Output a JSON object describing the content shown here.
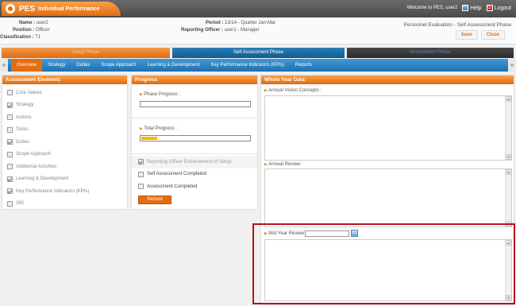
{
  "app": {
    "logo": "PES",
    "title": "Individual Performance",
    "welcome": "Welcome to PES, user2",
    "help": "Help",
    "logout": "Logout"
  },
  "info": {
    "name_label": "Name :",
    "name_value": "user2",
    "position_label": "Position :",
    "position_value": "Officer",
    "classification_label": "Classification :",
    "classification_value": "T1",
    "period_label": "Period :",
    "period_value": "13/14 - Quarter Jan-Mar",
    "officer_label": "Reporting Officer :",
    "officer_value": "user1 - Manager",
    "evaluation_title": "Personnel Evaluation - Self Assessment Phase",
    "save": "Save",
    "close": "Close"
  },
  "phases": [
    "Setup Phase",
    "Self Assessment Phase",
    "Assessment Phase"
  ],
  "tabs": [
    "Overview",
    "Strategy",
    "Duties",
    "Scope Approach",
    "Learning & Development",
    "Key Performance Indicators (KPIs)",
    "Reports"
  ],
  "assessment": {
    "title": "Assessment Elements",
    "items": [
      {
        "label": "Core Values",
        "checked": false
      },
      {
        "label": "Strategy",
        "checked": true
      },
      {
        "label": "Actions",
        "checked": false
      },
      {
        "label": "Tasks",
        "checked": false
      },
      {
        "label": "Duties",
        "checked": true
      },
      {
        "label": "Scope Approach",
        "checked": false
      },
      {
        "label": "Additional Activities",
        "checked": false
      },
      {
        "label": "Learning & Development",
        "checked": true
      },
      {
        "label": "Key Performance Indicators (KPIs)",
        "checked": true
      },
      {
        "label": "360",
        "checked": false
      }
    ]
  },
  "progress": {
    "title": "Progress",
    "phase_label": "Phase Progress :",
    "phase_value": 0,
    "total_label": "Total Progress :",
    "total_value": 0.15,
    "checks": [
      {
        "label": "Reporting Officer Endorsement of Setup",
        "checked": true
      },
      {
        "label": "Self Assessment Completed",
        "checked": false
      },
      {
        "label": "Assessment Completed",
        "checked": false
      }
    ],
    "refund": "Refund"
  },
  "whole_year": {
    "title": "Whole Year Data",
    "annual_vision": "Annual Vision Concepts :",
    "annual_review": "Annual Review :",
    "mid_year": "Mid-Year Review :"
  },
  "colors": {
    "accent_orange": "#e36d10",
    "nav_blue": "#1f6fae",
    "highlight_red": "#b3141c"
  }
}
